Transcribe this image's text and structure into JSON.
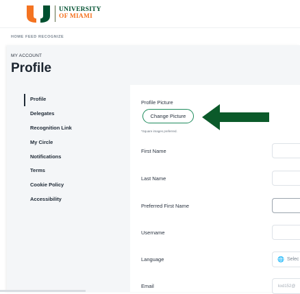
{
  "brand": {
    "line1": "UNIVERSITY",
    "line2": "OF MIAMI",
    "green": "#005030",
    "orange": "#f47321"
  },
  "nav": {
    "items": [
      "HOME",
      "FEED",
      "RECOGNIZE"
    ]
  },
  "page": {
    "breadcrumb": "MY ACCOUNT",
    "title": "Profile"
  },
  "sidebar": {
    "items": [
      {
        "label": "Profile",
        "active": true
      },
      {
        "label": "Delegates"
      },
      {
        "label": "Recognition Link"
      },
      {
        "label": "My Circle"
      },
      {
        "label": "Notifications"
      },
      {
        "label": "Terms"
      },
      {
        "label": "Cookie Policy"
      },
      {
        "label": "Accessibility"
      }
    ]
  },
  "form": {
    "picture_label": "Profile Picture",
    "change_picture_button": "Change Picture",
    "picture_hint": "*Square images preferred.",
    "first_name_label": "First Name",
    "last_name_label": "Last Name",
    "preferred_first_name_label": "Preferred First Name",
    "username_label": "Username",
    "language_label": "Language",
    "language_select_text": "Selec",
    "email_label": "Email",
    "email_value": "kxd152@"
  },
  "annotation": {
    "arrow_color": "#0b5a2a"
  },
  "icons": {
    "globe": "globe-icon",
    "arrow": "left-arrow-icon",
    "logo": "u-logo-icon"
  }
}
